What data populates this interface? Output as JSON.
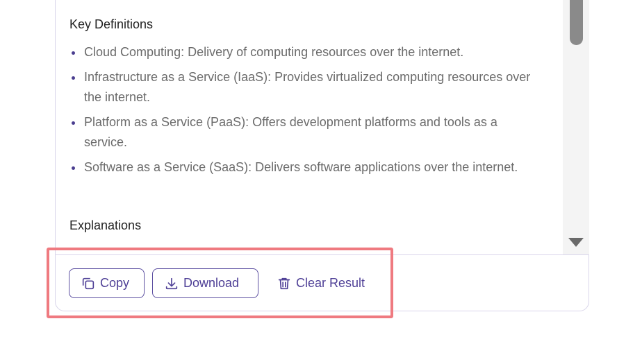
{
  "content": {
    "key_definitions_heading": "Key Definitions",
    "definitions": [
      "Cloud Computing: Delivery of computing resources over the internet.",
      "Infrastructure as a Service (IaaS): Provides virtualized computing resources over the internet.",
      "Platform as a Service (PaaS): Offers development platforms and tools as a service.",
      "Software as a Service (SaaS): Delivers software applications over the internet."
    ],
    "explanations_heading": "Explanations"
  },
  "actions": {
    "copy_label": "Copy",
    "download_label": "Download",
    "clear_label": "Clear Result"
  },
  "colors": {
    "accent": "#4e3f96",
    "highlight": "#ef7a80",
    "border": "#d9d5ea"
  }
}
